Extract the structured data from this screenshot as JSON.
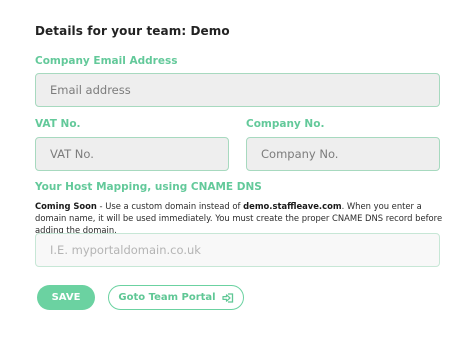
{
  "page": {
    "heading": "Details for your team: Demo"
  },
  "company_email": {
    "label": "Company Email Address",
    "placeholder": "Email address",
    "value": ""
  },
  "vat": {
    "label": "VAT No.",
    "placeholder": "VAT No.",
    "value": ""
  },
  "company_no": {
    "label": "Company No.",
    "placeholder": "Company No.",
    "value": ""
  },
  "host_mapping": {
    "label": "Your Host Mapping, using CNAME DNS",
    "coming_soon": "Coming Soon",
    "text_before_domain": " - Use a custom domain instead of ",
    "domain": "demo.staffleave.com",
    "text_after_domain": ". When you enter a domain name, it will be used immediately. You must create the proper CNAME DNS record before adding the domain.",
    "placeholder": "I.E. myportaldomain.co.uk",
    "value": ""
  },
  "actions": {
    "save_label": "SAVE",
    "portal_label": "Goto Team Portal",
    "portal_icon": "sign-in-arrow-icon"
  },
  "colors": {
    "accent": "#6bd2a1",
    "label_green": "#63c99a",
    "field_bg": "#eeeeee",
    "field_border": "#a7d9bf"
  }
}
